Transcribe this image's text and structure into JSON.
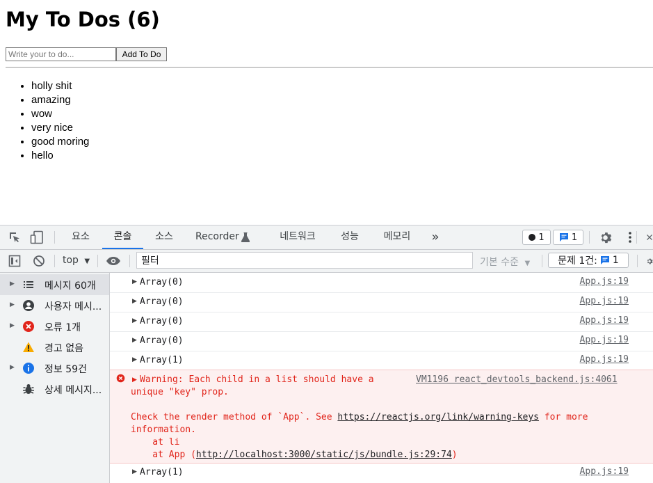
{
  "app": {
    "title": "My To Dos (6)",
    "input": {
      "placeholder": "Write your to do...",
      "value": ""
    },
    "add_button": "Add To Do",
    "todos": [
      "holly shit",
      "amazing",
      "wow",
      "very nice",
      "good moring",
      "hello"
    ]
  },
  "devtools": {
    "tabs": [
      "요소",
      "콘솔",
      "소스",
      "Recorder",
      "네트워크",
      "성능",
      "메모리"
    ],
    "active_tab": "콘솔",
    "more_tabs": "»",
    "error_badge_count": "1",
    "issue_badge_count": "1",
    "toolbar": {
      "context": "top",
      "filter_value": "필터",
      "level": "기본 수준",
      "issues_label": "문제 1건:",
      "issues_count": "1"
    },
    "sidebar": [
      {
        "label": "메시지 60개",
        "icon": "list-icon",
        "has_arrow": true
      },
      {
        "label": "사용자 메시...",
        "icon": "user-icon",
        "has_arrow": true
      },
      {
        "label": "오류 1개",
        "icon": "error-icon",
        "has_arrow": true
      },
      {
        "label": "경고 없음",
        "icon": "warning-icon",
        "has_arrow": false
      },
      {
        "label": "정보 59건",
        "icon": "info-icon",
        "has_arrow": true
      },
      {
        "label": "상세 메시지...",
        "icon": "bug-icon",
        "has_arrow": false
      }
    ],
    "messages_before": [
      {
        "text": "Array(0)",
        "source": "App.js:19"
      },
      {
        "text": "Array(0)",
        "source": "App.js:19"
      },
      {
        "text": "Array(0)",
        "source": "App.js:19"
      },
      {
        "text": "Array(0)",
        "source": "App.js:19"
      },
      {
        "text": "Array(1)",
        "source": "App.js:19"
      }
    ],
    "error": {
      "line1": "Warning: Each child in a list should have a",
      "source": "VM1196 react_devtools_backend.js:4061",
      "line2": "unique \"key\" prop.",
      "line3_prefix": "Check the render method of `App`. See ",
      "link": "https://reactjs.org/link/warning-keys",
      "line3_suffix": " for more",
      "line4": "information.",
      "line5": "    at li",
      "line6_prefix": "    at App (",
      "line6_link": "http://localhost:3000/static/js/bundle.js:29:74",
      "line6_suffix": ")"
    },
    "messages_after": [
      {
        "text": "Array(1)",
        "source": "App.js:19"
      }
    ],
    "colors": {
      "accent": "#1a73e8",
      "error": "#e1251b",
      "warning": "#f9ab00",
      "info": "#1a73e8"
    }
  }
}
